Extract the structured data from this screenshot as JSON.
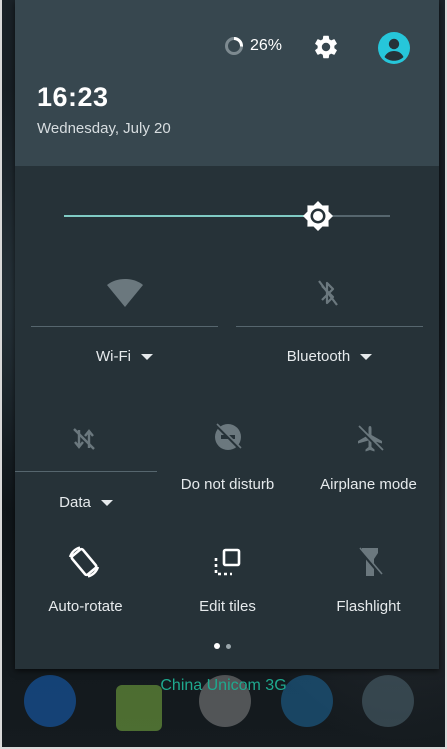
{
  "status": {
    "battery_percent": "26%",
    "battery_level": 0.26
  },
  "header": {
    "time": "16:23",
    "date": "Wednesday, July 20"
  },
  "brightness": {
    "level": 0.78
  },
  "tiles": {
    "wifi": {
      "label": "Wi-Fi",
      "icon": "wifi-icon"
    },
    "bluetooth": {
      "label": "Bluetooth",
      "icon": "bluetooth-off-icon"
    },
    "data": {
      "label": "Data",
      "icon": "mobile-data-off-icon"
    },
    "dnd": {
      "label": "Do not disturb",
      "icon": "do-not-disturb-off-icon"
    },
    "airplane": {
      "label": "Airplane mode",
      "icon": "airplane-off-icon"
    },
    "autorotate": {
      "label": "Auto-rotate",
      "icon": "auto-rotate-icon"
    },
    "edit": {
      "label": "Edit tiles",
      "icon": "edit-tiles-icon"
    },
    "flashlight": {
      "label": "Flashlight",
      "icon": "flashlight-off-icon"
    }
  },
  "pager": {
    "pages": 2,
    "current": 1
  },
  "background": {
    "carrier": "China Unicom 3G"
  },
  "colors": {
    "shade": "#263238",
    "header": "#37474f",
    "accent": "#80cbc4",
    "avatar": "#26c6da"
  }
}
